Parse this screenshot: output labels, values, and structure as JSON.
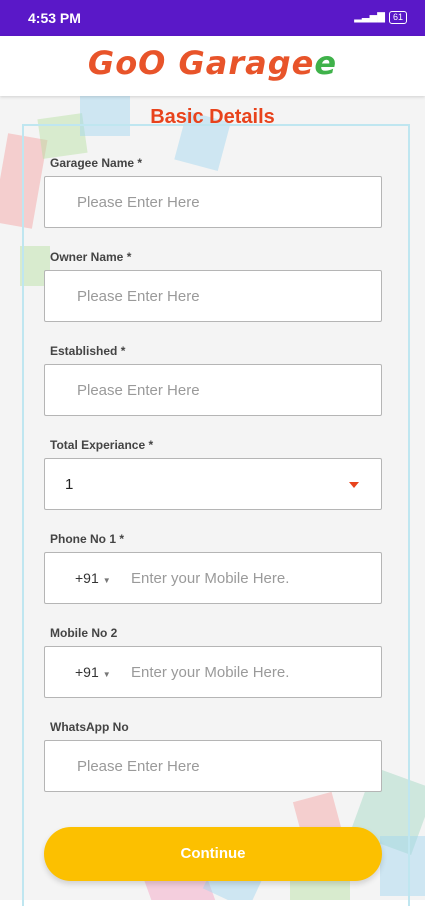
{
  "status": {
    "time": "4:53 PM",
    "battery": "61"
  },
  "app": {
    "logo_part1": "GoO ",
    "logo_part2": "Garage",
    "logo_part3": "e"
  },
  "page": {
    "title": "Basic Details"
  },
  "fields": {
    "garage_name": {
      "label": "Garagee Name *",
      "placeholder": "Please Enter Here"
    },
    "owner_name": {
      "label": "Owner Name *",
      "placeholder": "Please Enter Here"
    },
    "established": {
      "label": "Established *",
      "placeholder": "Please Enter Here"
    },
    "experience": {
      "label": "Total Experiance *",
      "value": "1"
    },
    "phone1": {
      "label": "Phone No 1 *",
      "code": "+91",
      "placeholder": "Enter your Mobile Here."
    },
    "mobile2": {
      "label": "Mobile No 2",
      "code": "+91",
      "placeholder": "Enter your Mobile Here."
    },
    "whatsapp": {
      "label": "WhatsApp No",
      "placeholder": "Please Enter Here"
    }
  },
  "actions": {
    "continue": "Continue"
  },
  "colors": {
    "status_bar": "#5a18c8",
    "accent": "#e8431c",
    "logo_green": "#3fb24a",
    "button": "#fcc000"
  }
}
